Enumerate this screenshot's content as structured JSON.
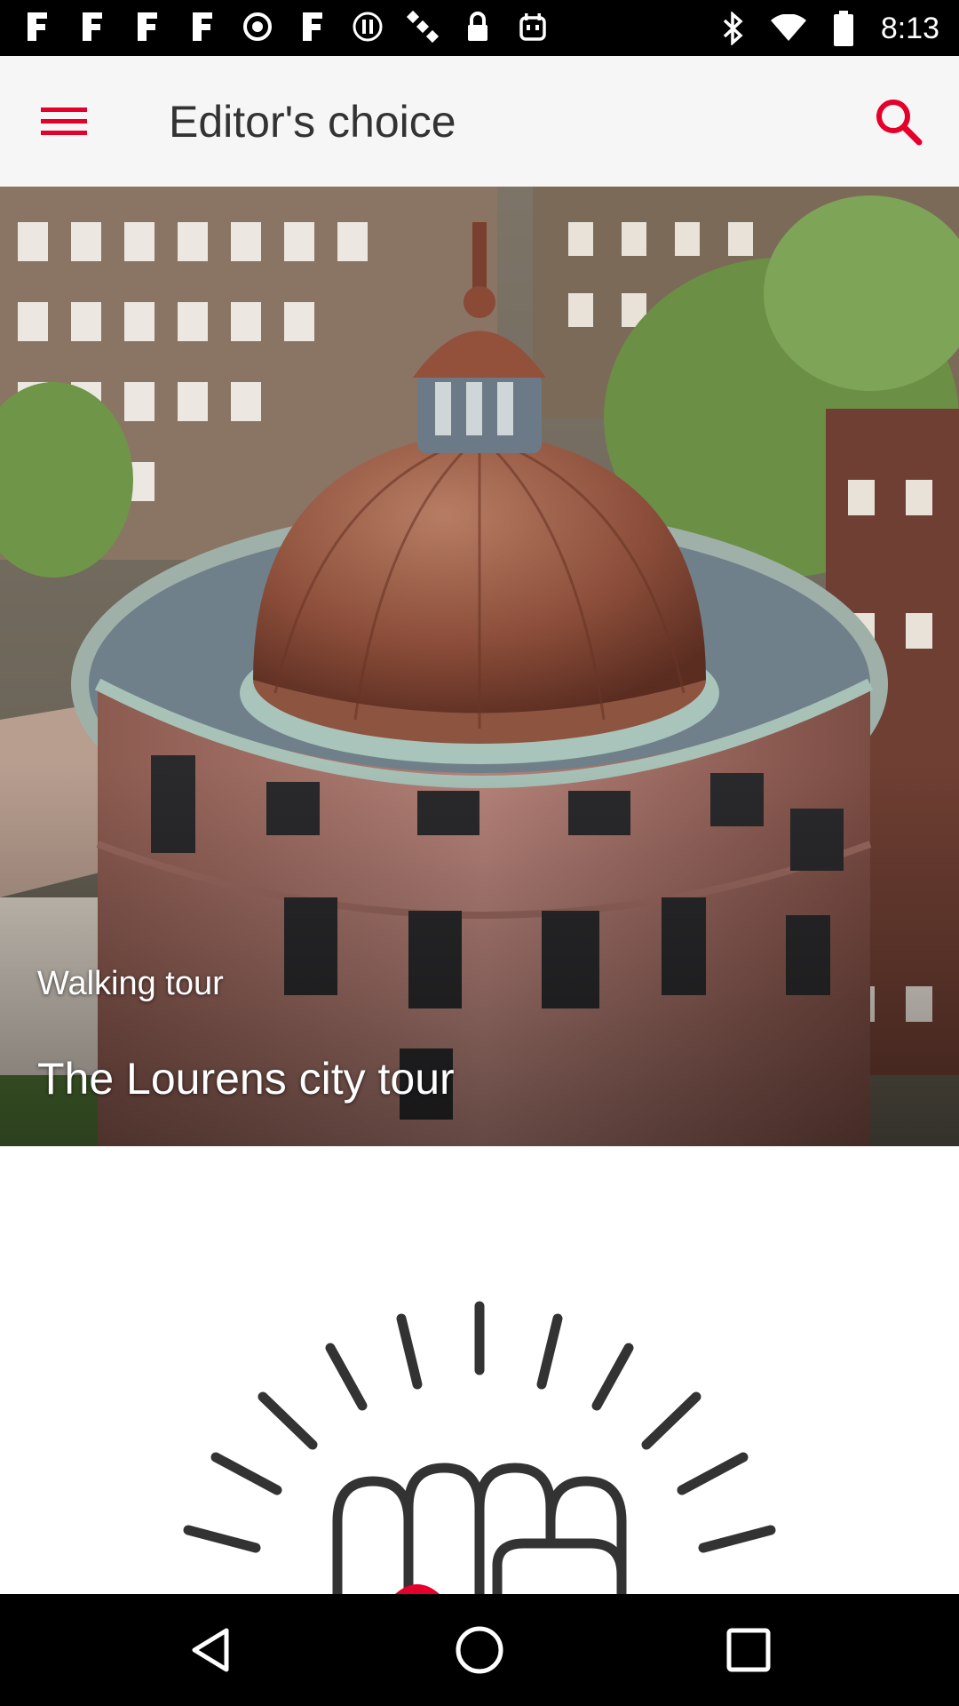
{
  "status_bar": {
    "time": "8:13",
    "left_icons": [
      "facebook-icon",
      "facebook-icon",
      "facebook-icon",
      "facebook-icon",
      "record-icon",
      "facebook-icon",
      "pause-icon",
      "satellite-icon",
      "lock-icon",
      "android-icon"
    ],
    "right_icons": [
      "bluetooth-icon",
      "wifi-icon",
      "battery-icon"
    ]
  },
  "app_bar": {
    "title": "Editor's choice",
    "menu_icon": "hamburger-menu-icon",
    "search_icon": "search-icon",
    "accent_color": "#e4002b"
  },
  "hero_card": {
    "category": "Walking tour",
    "title": "The Lourens city tour"
  },
  "second_card": {
    "illustration": "fist-bump-icon"
  },
  "nav_bar": {
    "back_icon": "back-triangle-icon",
    "home_icon": "home-circle-icon",
    "recents_icon": "recents-square-icon"
  }
}
